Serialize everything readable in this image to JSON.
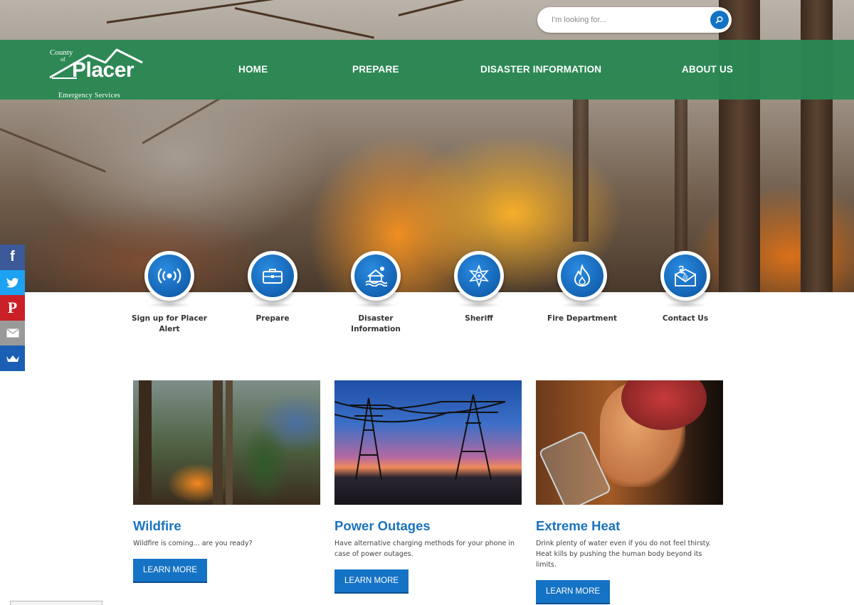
{
  "search": {
    "placeholder": "I'm looking for..."
  },
  "logo": {
    "line1": "County",
    "line2": "of",
    "name": "Placer",
    "subtitle": "Emergency Services"
  },
  "nav": [
    {
      "label": "HOME"
    },
    {
      "label": "PREPARE"
    },
    {
      "label": "DISASTER INFORMATION"
    },
    {
      "label": "ABOUT US"
    }
  ],
  "social": [
    {
      "icon": "facebook-icon",
      "glyph": "f",
      "color": "#3b5998"
    },
    {
      "icon": "twitter-icon",
      "glyph": "t",
      "color": "#1da1f2"
    },
    {
      "icon": "pinterest-icon",
      "glyph": "p",
      "color": "#cb2027"
    },
    {
      "icon": "email-icon",
      "glyph": "✉",
      "color": "#9a9a9a"
    },
    {
      "icon": "crown-share-icon",
      "glyph": "♛",
      "color": "#1a5fb4"
    }
  ],
  "quick_links": [
    {
      "label": "Sign up for Placer Alert",
      "icon": "broadcast-icon"
    },
    {
      "label": "Prepare",
      "icon": "briefcase-icon"
    },
    {
      "label": "Disaster Information",
      "icon": "flooded-house-icon"
    },
    {
      "label": "Sheriff",
      "icon": "sheriff-badge-icon"
    },
    {
      "label": "Fire Department",
      "icon": "flame-icon"
    },
    {
      "label": "Contact Us",
      "icon": "contact-envelope-icon"
    }
  ],
  "cards": [
    {
      "title": "Wildfire",
      "text": "Wildfire is coming... are you ready?",
      "button": "LEARN MORE"
    },
    {
      "title": "Power Outages",
      "text": "Have alternative charging methods for your phone in case of power outages.",
      "button": "LEARN MORE"
    },
    {
      "title": "Extreme Heat",
      "text": "Drink plenty of water even if you do not feel thirsty. Heat kills by pushing the human body beyond its limits.",
      "button": "LEARN MORE"
    }
  ],
  "colors": {
    "nav_green": "#298753",
    "brand_blue": "#1573c5",
    "title_blue": "#1a73bf"
  }
}
